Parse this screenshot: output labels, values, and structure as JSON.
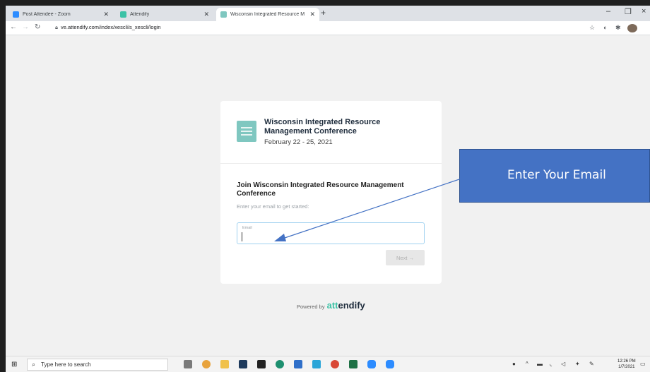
{
  "browser": {
    "tabs": [
      {
        "title": "Post Attendee - Zoom",
        "active": false
      },
      {
        "title": "Attendify",
        "active": false
      },
      {
        "title": "Wisconsin Integrated Resource M",
        "active": true
      }
    ],
    "new_tab": "+",
    "url": "ve.attendify.com/index/xescli/s_xescli/login",
    "window_controls": [
      "–",
      "❐",
      "×"
    ]
  },
  "conference": {
    "title": "Wisconsin Integrated Resource Management Conference",
    "dates": "February 22 - 25, 2021"
  },
  "login": {
    "heading": "Join Wisconsin Integrated Resource Management Conference",
    "subheading": "Enter your email to get started:",
    "email_label": "Email",
    "email_value": "",
    "next_label": "Next →"
  },
  "footer": {
    "powered_by": "Powered by",
    "brand_prefix": "att",
    "brand_suffix": "endify"
  },
  "callout": {
    "text": "Enter Your Email",
    "color": "#4472c4"
  },
  "taskbar": {
    "search_placeholder": "Type here to search",
    "time": "12:26 PM",
    "date": "1/7/2021"
  },
  "colors": {
    "accent_teal": "#7fc7c0",
    "brand_green": "#3cc2a6",
    "input_border": "#9fd1f0"
  }
}
